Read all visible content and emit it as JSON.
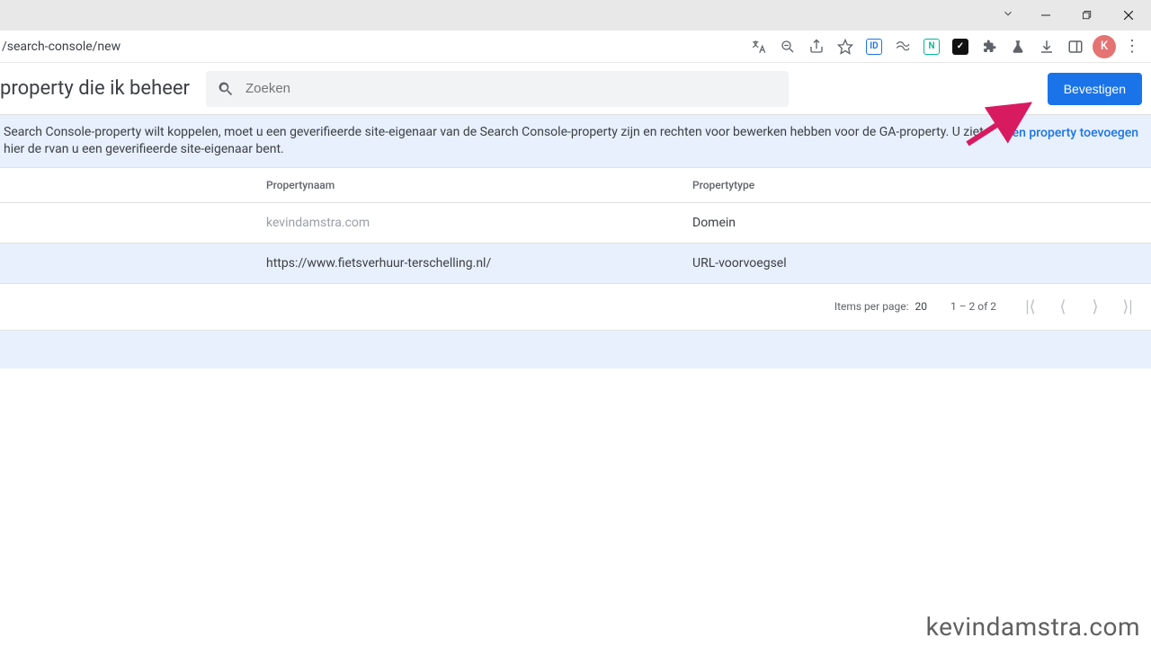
{
  "browser": {
    "url_fragment": "/search-console/new",
    "avatar_initial": "K"
  },
  "header": {
    "title": "property die ik beheer",
    "search_placeholder": "Zoeken",
    "confirm_label": "Bevestigen"
  },
  "banner": {
    "text": "Search Console-property wilt koppelen, moet u een geverifieerde site-eigenaar van de Search Console-property zijn en rechten voor bewerken hebben voor de GA-property. U ziet hier de rvan u een geverifieerde site-eigenaar bent.",
    "link_label": "Een property toevoegen"
  },
  "table": {
    "columns": {
      "name": "Propertynaam",
      "type": "Propertytype"
    },
    "rows": [
      {
        "name": "kevindamstra.com",
        "type": "Domein",
        "muted": true,
        "selected": false
      },
      {
        "name": "https://www.fietsverhuur-terschelling.nl/",
        "type": "URL-voorvoegsel",
        "muted": false,
        "selected": true
      }
    ]
  },
  "pager": {
    "items_per_page_label": "Items per page:",
    "items_per_page_value": "20",
    "range_text": "1 – 2 of 2"
  },
  "watermark": "kevindamstra.com"
}
